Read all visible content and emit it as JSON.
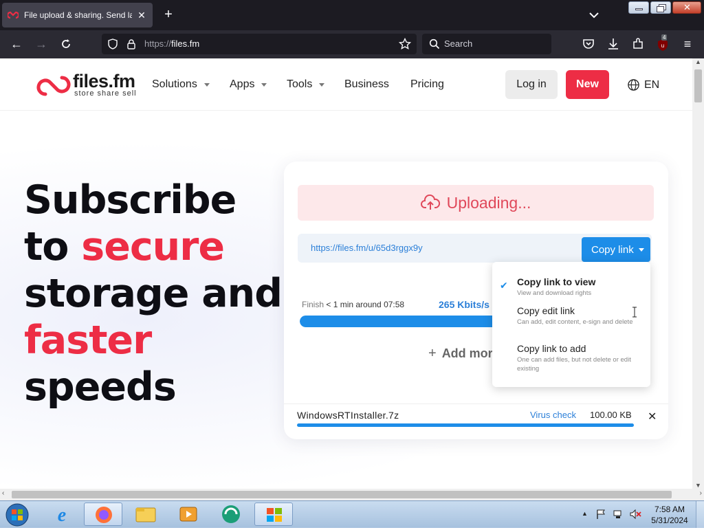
{
  "browser": {
    "tab_title": "File upload & sharing. Send large files",
    "url_scheme": "https://",
    "url_host": "files.fm",
    "search_placeholder": "Search",
    "notification_badge": "4"
  },
  "site": {
    "logo_name": "files.fm",
    "logo_tagline": "store share sell",
    "nav": [
      "Solutions",
      "Apps",
      "Tools",
      "Business",
      "Pricing"
    ],
    "login_label": "Log in",
    "new_label": "New",
    "lang_label": "EN"
  },
  "hero": {
    "line1": "Subscribe",
    "line2_a": "to ",
    "line2_b": "secure",
    "line3": "storage and",
    "line4": "faster",
    "line5": "speeds"
  },
  "upload": {
    "status": "Uploading...",
    "link": "https://files.fm/u/65d3rggx9y",
    "copy_label": "Copy link",
    "finish_label": "Finish",
    "finish_value": " < 1 min around 07:58",
    "speed": "265 Kbits/s",
    "progress": 0.62,
    "add_more": "Add more files",
    "file_name": "WindowsRTInstaller.7z",
    "virus_check": "Virus check",
    "file_size": "100.00 KB",
    "file_progress": 1.0
  },
  "copy_menu": {
    "items": [
      {
        "title": "Copy link to view",
        "desc": "View and download rights",
        "selected": true
      },
      {
        "title": "Copy edit link",
        "desc": "Can add, edit content, e-sign and delete",
        "selected": false
      },
      {
        "title": "Copy link to add",
        "desc": "One can add files, but not delete or edit existing",
        "selected": false
      }
    ]
  },
  "taskbar": {
    "time": "7:58 AM",
    "date": "5/31/2024"
  },
  "colors": {
    "brand_red": "#ed2d45",
    "accent_blue": "#1d8de8"
  }
}
